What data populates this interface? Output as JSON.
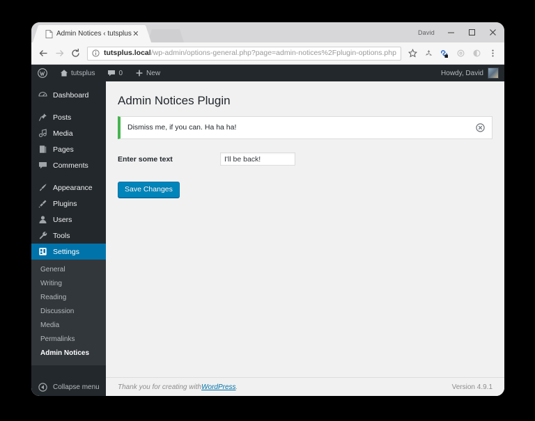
{
  "browser": {
    "tab": {
      "title": "Admin Notices ‹ tutsplus",
      "close_label": "✕"
    },
    "window_controls": {
      "profile_name": "David",
      "minimize": "–",
      "maximize": "▢",
      "close": "✕"
    },
    "toolbar": {
      "back": "←",
      "forward": "→",
      "reload": "⟳",
      "url_secure_prefix": "tutsplus.local",
      "url_rest": "/wp-admin/options-general.php?page=admin-notices%2Fplugin-options.php",
      "url_full": "tutsplus.local/wp-admin/options-general.php?page=admin-notices%2Fplugin-options.php",
      "icons": [
        "star-icon",
        "recycle-extension-icon",
        "link-extension-icon",
        "settings-extension-icon",
        "moon-extension-icon",
        "chrome-menu-icon"
      ]
    }
  },
  "adminbar": {
    "logo": "wordpress-logo",
    "site_name": "tutsplus",
    "comments_count": "0",
    "new_label": "New",
    "howdy": "Howdy, David"
  },
  "sidebar": {
    "items": [
      {
        "label": "Dashboard",
        "icon": "dashboard-icon",
        "active": false
      },
      {
        "label": "Posts",
        "icon": "pin-icon",
        "active": false
      },
      {
        "label": "Media",
        "icon": "media-icon",
        "active": false
      },
      {
        "label": "Pages",
        "icon": "page-icon",
        "active": false
      },
      {
        "label": "Comments",
        "icon": "comment-icon",
        "active": false
      },
      {
        "label": "Appearance",
        "icon": "brush-icon",
        "active": false
      },
      {
        "label": "Plugins",
        "icon": "plug-icon",
        "active": false
      },
      {
        "label": "Users",
        "icon": "user-icon",
        "active": false
      },
      {
        "label": "Tools",
        "icon": "wrench-icon",
        "active": false
      },
      {
        "label": "Settings",
        "icon": "settings-gear-icon",
        "active": true
      }
    ],
    "submenu": [
      {
        "label": "General",
        "current": false
      },
      {
        "label": "Writing",
        "current": false
      },
      {
        "label": "Reading",
        "current": false
      },
      {
        "label": "Discussion",
        "current": false
      },
      {
        "label": "Media",
        "current": false
      },
      {
        "label": "Permalinks",
        "current": false
      },
      {
        "label": "Admin Notices",
        "current": true
      }
    ],
    "collapse_label": "Collapse menu"
  },
  "main": {
    "page_title": "Admin Notices Plugin",
    "notice": {
      "text": "Dismiss me, if you can. Ha ha ha!",
      "accent_color": "#46b450",
      "dismiss_label": "✕"
    },
    "form": {
      "label": "Enter some text",
      "input_value": "I'll be back!",
      "input_placeholder": "",
      "submit_label": "Save Changes"
    }
  },
  "footer": {
    "thanks_prefix": "Thank you for creating with ",
    "wordpress_link": "WordPress",
    "thanks_suffix": ".",
    "version": "Version 4.9.1"
  },
  "colors": {
    "wp_admin_dark": "#23282d",
    "wp_submenu_dark": "#32373c",
    "wp_blue": "#0073aa",
    "wp_button": "#0085ba",
    "notice_green": "#46b450",
    "content_bg": "#f1f1f1"
  }
}
